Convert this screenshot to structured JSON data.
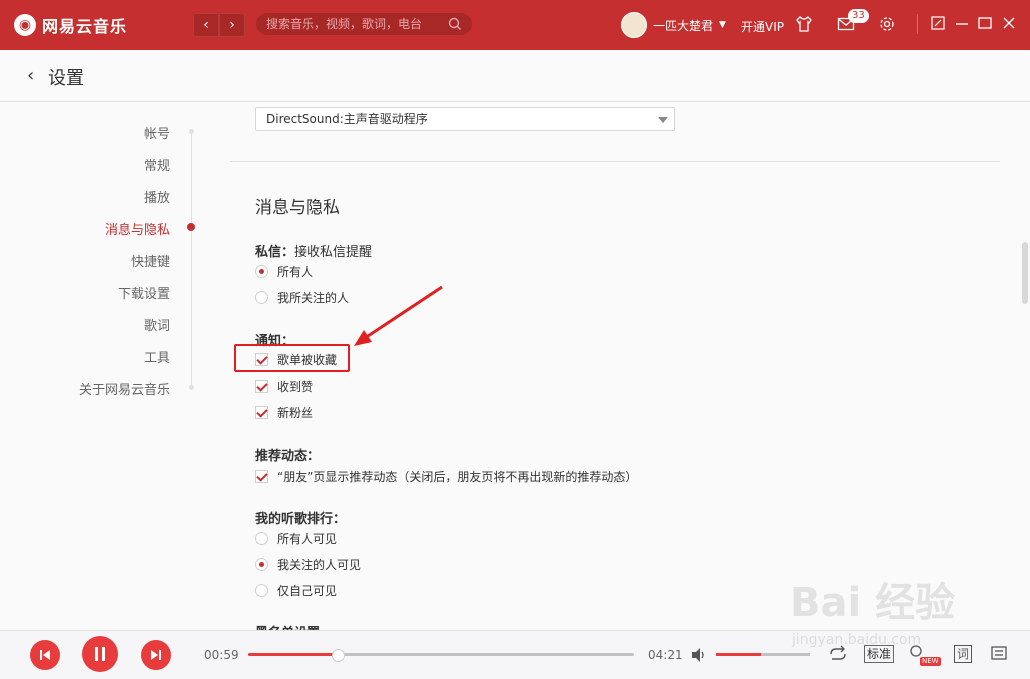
{
  "app": {
    "name": "网易云音乐",
    "search_placeholder": "搜索音乐，视频，歌词，电台",
    "username": "一匹大楚君",
    "vip_label": "开通VIP",
    "message_count": "33",
    "brand_color": "#c62f2f"
  },
  "header": {
    "title": "设置"
  },
  "sidebar": {
    "items": [
      {
        "label": "帐号",
        "active": false
      },
      {
        "label": "常规",
        "active": false
      },
      {
        "label": "播放",
        "active": false
      },
      {
        "label": "消息与隐私",
        "active": true
      },
      {
        "label": "快捷键",
        "active": false
      },
      {
        "label": "下载设置",
        "active": false
      },
      {
        "label": "歌词",
        "active": false
      },
      {
        "label": "工具",
        "active": false
      },
      {
        "label": "关于网易云音乐",
        "active": false
      }
    ]
  },
  "main": {
    "output_device": "DirectSound:主声音驱动程序",
    "section_title": "消息与隐私",
    "private_message": {
      "label": "私信：",
      "sub": "接收私信提醒",
      "options": [
        {
          "label": "所有人",
          "selected": true
        },
        {
          "label": "我所关注的人",
          "selected": false
        }
      ]
    },
    "notifications": {
      "label": "通知：",
      "options": [
        {
          "label": "歌单被收藏",
          "checked": true
        },
        {
          "label": "收到赞",
          "checked": true
        },
        {
          "label": "新粉丝",
          "checked": true
        }
      ]
    },
    "recommend": {
      "label": "推荐动态：",
      "options": [
        {
          "label": "“朋友”页显示推荐动态（关闭后，朋友页将不再出现新的推荐动态）",
          "checked": true
        }
      ]
    },
    "ranking": {
      "label": "我的听歌排行：",
      "options": [
        {
          "label": "所有人可见",
          "selected": false
        },
        {
          "label": "我关注的人可见",
          "selected": true
        },
        {
          "label": "仅自己可见",
          "selected": false
        }
      ]
    },
    "next_section": "黑名单设置"
  },
  "player": {
    "current_time": "00:59",
    "total_time": "04:21",
    "progress": 0.23,
    "volume": 0.48,
    "quality_label": "标准",
    "new_badge": "NEW",
    "lyrics_label": "词"
  },
  "watermark": {
    "main": "Bai 经验",
    "sub": "jingyan.baidu.com"
  }
}
